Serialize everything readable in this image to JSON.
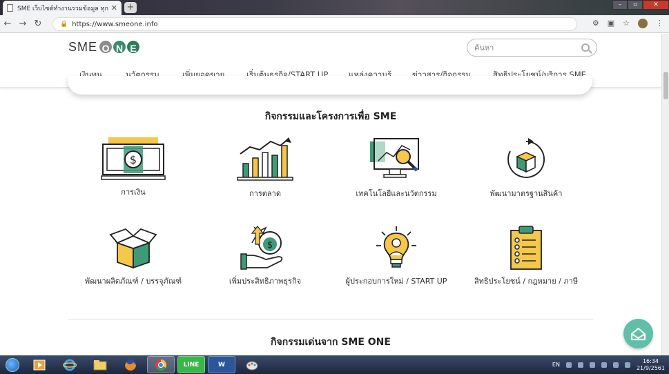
{
  "browser": {
    "tab_title": "SME เว็บไซต์ทำงานรวมข้อมูล ทุกเรื่อง",
    "tab_close": "✕",
    "new_tab": "+",
    "back": "←",
    "forward": "→",
    "reload": "↻",
    "url": "https://www.smeone.info"
  },
  "site": {
    "logo_text": "SME",
    "logo_letters": [
      "O",
      "N",
      "E"
    ],
    "search_placeholder": "ค้นหา",
    "nav": [
      "เงินทุน",
      "นวัตกรรม",
      "เพิ่มยอดขาย",
      "เริ่มต้นธุรกิจ/START UP",
      "แหล่งความรู้",
      "ข่าวสาร/กิจกรรม",
      "สิทธิประโยชน์/บริการ SME"
    ]
  },
  "section1": {
    "title": "กิจกรรมและโครงการเพื่อ SME",
    "items": [
      {
        "label": "การเงิน",
        "icon": "money-bill-icon"
      },
      {
        "label": "การตลาด",
        "icon": "growth-chart-icon"
      },
      {
        "label": "เทคโนโลยีและนวัตกรรม",
        "icon": "monitor-magnifier-icon"
      },
      {
        "label": "พัฒนามาตรฐานสินค้า",
        "icon": "box-cycle-icon"
      },
      {
        "label": "พัฒนาผลิตภัณฑ์ / บรรจุภัณฑ์",
        "icon": "open-box-icon"
      },
      {
        "label": "เพิ่มประสิทธิภาพธุรกิจ",
        "icon": "money-bag-hand-icon"
      },
      {
        "label": "ผู้ประกอบการใหม่ / START UP",
        "icon": "lightbulb-person-icon"
      },
      {
        "label": "สิทธิประโยชน์ / กฎหมาย / ภาษี",
        "icon": "clipboard-checklist-icon"
      }
    ]
  },
  "section2": {
    "title": "กิจกรรมเด่นจาก SME ONE"
  },
  "taskbar": {
    "apps": [
      "media-player",
      "internet-explorer",
      "file-explorer",
      "firefox",
      "chrome",
      "line",
      "word",
      "paint"
    ],
    "app_labels": {
      "line": "LINE",
      "word": "W"
    },
    "lang": "EN",
    "time": "16:34",
    "date": "21/9/2561"
  },
  "colors": {
    "yellow": "#f5c74a",
    "green": "#3e9b78",
    "outline": "#222222",
    "teal_button": "#5fbfa8"
  }
}
